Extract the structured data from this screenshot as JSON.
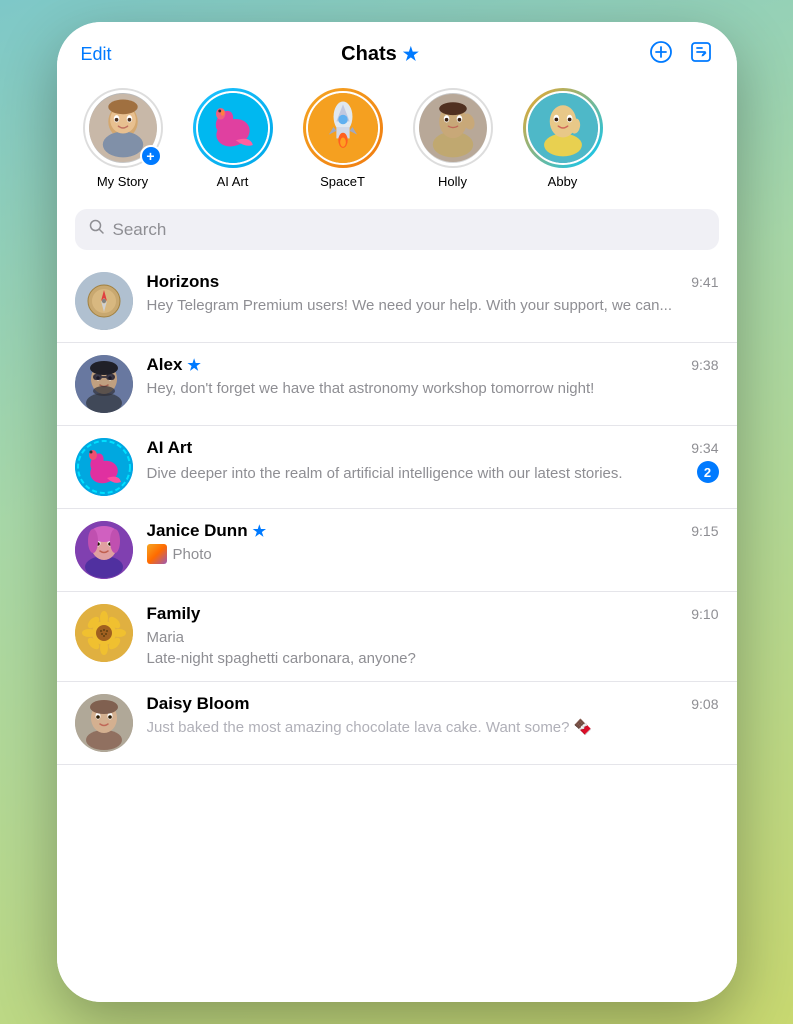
{
  "header": {
    "edit_label": "Edit",
    "title": "Chats",
    "title_star": "★",
    "new_chat_icon": "⊕",
    "compose_icon": "✏"
  },
  "stories": [
    {
      "id": "my-story",
      "label": "My Story",
      "ring": "none",
      "emoji": "👩",
      "has_plus": true
    },
    {
      "id": "ai-art",
      "label": "AI Art",
      "ring": "gradient",
      "emoji": "🦜"
    },
    {
      "id": "spacet",
      "label": "SpaceT",
      "ring": "orange",
      "emoji": "🚀"
    },
    {
      "id": "holly",
      "label": "Holly",
      "ring": "none",
      "emoji": "🧕"
    },
    {
      "id": "abby",
      "label": "Abby",
      "ring": "gradient",
      "emoji": "✌"
    }
  ],
  "search": {
    "placeholder": "Search"
  },
  "chats": [
    {
      "id": "horizons",
      "name": "Horizons",
      "time": "9:41",
      "preview": "Hey Telegram Premium users!  We need your help. With your support, we can...",
      "starred": false,
      "unread": 0,
      "avatar_type": "horizons",
      "avatar_emoji": "🧭"
    },
    {
      "id": "alex",
      "name": "Alex",
      "time": "9:38",
      "preview": "Hey, don't forget we have that astronomy workshop tomorrow night!",
      "starred": true,
      "unread": 0,
      "avatar_type": "alex",
      "avatar_emoji": "🧔"
    },
    {
      "id": "ai-art",
      "name": "AI Art",
      "time": "9:34",
      "preview": "Dive deeper into the realm of artificial intelligence with our latest stories.",
      "starred": false,
      "unread": 2,
      "avatar_type": "aiart",
      "avatar_emoji": "🦜"
    },
    {
      "id": "janice-dunn",
      "name": "Janice Dunn",
      "time": "9:15",
      "preview_type": "photo",
      "preview": "Photo",
      "starred": true,
      "unread": 0,
      "avatar_type": "janice",
      "avatar_emoji": "👩"
    },
    {
      "id": "family",
      "name": "Family",
      "time": "9:10",
      "preview": "Maria\nLate-night spaghetti carbonara, anyone?",
      "starred": false,
      "unread": 0,
      "avatar_type": "family",
      "avatar_emoji": "🌻"
    },
    {
      "id": "daisy-bloom",
      "name": "Daisy Bloom",
      "time": "9:08",
      "preview": "Just baked the most amazing chocolate lava cake. Want some? 🍫",
      "starred": false,
      "unread": 0,
      "avatar_type": "daisy",
      "avatar_emoji": "👩",
      "faded": true
    }
  ]
}
